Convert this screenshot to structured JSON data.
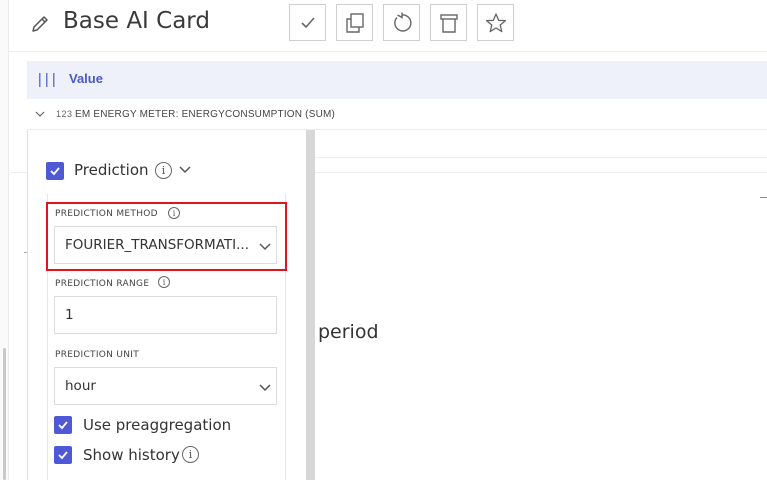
{
  "header": {
    "title": "Base AI Card",
    "tools": [
      {
        "name": "confirm-button",
        "icon": "checkmark-icon"
      },
      {
        "name": "duplicate-button",
        "icon": "copy-icon"
      },
      {
        "name": "reset-button",
        "icon": "refresh-icon"
      },
      {
        "name": "delete-button",
        "icon": "trash-icon"
      },
      {
        "name": "favorite-button",
        "icon": "star-icon"
      }
    ]
  },
  "value_bar": {
    "label": "Value",
    "icon": "bars-icon"
  },
  "energy_row": {
    "type_icon": "123",
    "label": "EM ENERGY METER: ENERGYCONSUMPTION (SUM)"
  },
  "background": {
    "period_text": "period"
  },
  "prediction": {
    "checked": true,
    "label": "Prediction",
    "method": {
      "label": "PREDICTION METHOD",
      "value": "FOURIER_TRANSFORMATI..."
    },
    "range": {
      "label": "PREDICTION RANGE",
      "value": "1"
    },
    "unit": {
      "label": "PREDICTION UNIT",
      "value": "hour"
    },
    "use_preaggregation": {
      "checked": true,
      "label": "Use preaggregation"
    },
    "show_history": {
      "checked": true,
      "label": "Show history"
    }
  },
  "colors": {
    "accent": "#4f59d6",
    "highlight": "#e0141c",
    "value_bar": "#eef1f9"
  }
}
